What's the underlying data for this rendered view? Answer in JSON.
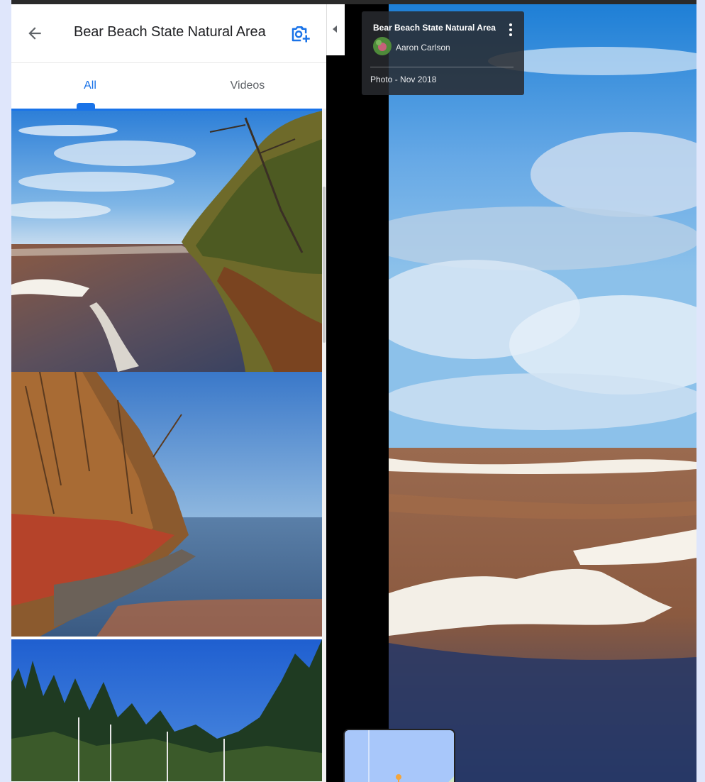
{
  "header": {
    "title": "Bear Beach State Natural Area"
  },
  "tabs": {
    "all": "All",
    "videos": "Videos"
  },
  "info_card": {
    "title": "Bear Beach State Natural Area",
    "author": "Aaron Carlson",
    "date_label": "Photo - Nov 2018"
  },
  "colors": {
    "accent": "#1a73e8",
    "card_bg": "#282a2e"
  },
  "icons": [
    "back-arrow-icon",
    "add-photo-camera-icon",
    "collapse-chevron-icon",
    "more-vert-icon"
  ]
}
